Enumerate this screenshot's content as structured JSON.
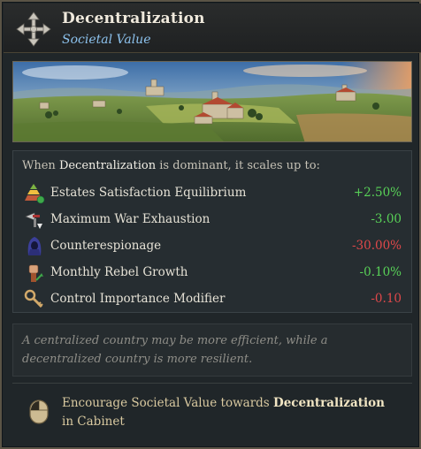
{
  "header": {
    "title": "Decentralization",
    "subtitle": "Societal Value",
    "icon": "arrows-cross-icon"
  },
  "effects": {
    "intro_prefix": "When ",
    "intro_highlight": "Decentralization",
    "intro_suffix": " is dominant, it scales up to:",
    "rows": [
      {
        "label": "Estates Satisfaction Equilibrium",
        "value": "+2.50%",
        "polarity": "positive",
        "icon": "estates-pyramid-icon"
      },
      {
        "label": "Maximum War Exhaustion",
        "value": "-3.00",
        "polarity": "positive",
        "icon": "war-exhaustion-icon"
      },
      {
        "label": "Counterespionage",
        "value": "-30.00%",
        "polarity": "negative",
        "icon": "hooded-spy-icon"
      },
      {
        "label": "Monthly Rebel Growth",
        "value": "-0.10%",
        "polarity": "positive",
        "icon": "rebel-fist-icon"
      },
      {
        "label": "Control Importance Modifier",
        "value": "-0.10",
        "polarity": "negative",
        "icon": "control-key-icon"
      }
    ]
  },
  "description": "A centralized country may be more efficient, while a decentralized country is more resilient.",
  "action": {
    "prefix": "Encourage Societal Value towards ",
    "highlight": "Decentralization",
    "suffix": " in Cabinet",
    "icon": "mouse-left-click-icon"
  },
  "colors": {
    "positive": "#58d157",
    "negative": "#e0484a",
    "subtitle": "#8cc1ec",
    "border": "#5b5446"
  }
}
